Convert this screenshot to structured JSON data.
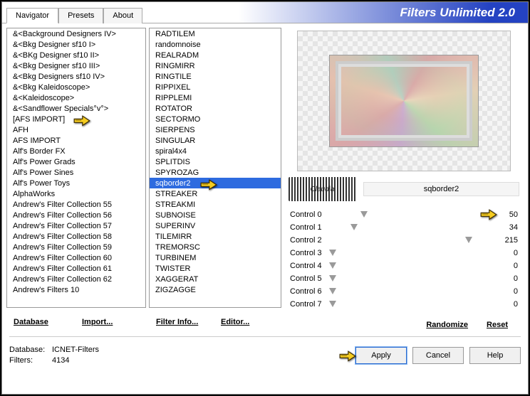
{
  "app_title": "Filters Unlimited 2.0",
  "tabs": [
    "Navigator",
    "Presets",
    "About"
  ],
  "active_tab": 0,
  "left_list": [
    "&<Background Designers IV>",
    "&<Bkg Designer sf10 I>",
    "&<BKg Designer sf10 II>",
    "&<Bkg Designer sf10 III>",
    "&<Bkg Designers sf10 IV>",
    "&<Bkg Kaleidoscope>",
    "&<Kaleidoscope>",
    "&<Sandflower Specials°v°>",
    "[AFS IMPORT]",
    "AFH",
    "AFS IMPORT",
    "Alf's Border FX",
    "Alf's Power Grads",
    "Alf's Power Sines",
    "Alf's Power Toys",
    "AlphaWorks",
    "Andrew's Filter Collection 55",
    "Andrew's Filter Collection 56",
    "Andrew's Filter Collection 57",
    "Andrew's Filter Collection 58",
    "Andrew's Filter Collection 59",
    "Andrew's Filter Collection 60",
    "Andrew's Filter Collection 61",
    "Andrew's Filter Collection 62",
    "Andrew's Filters 10"
  ],
  "left_selected_index": 8,
  "mid_list": [
    "RADTILEM",
    "randomnoise",
    "REALRADM",
    "RINGMIRR",
    "RINGTILE",
    "RIPPIXEL",
    "RIPPLEMI",
    "ROTATOR",
    "SECTORMO",
    "SIERPENS",
    "SINGULAR",
    "spiral4x4",
    "SPLITDIS",
    "SPYROZAG",
    "sqborder2",
    "STREAKER",
    "STREAKMI",
    "SUBNOISE",
    "SUPERINV",
    "TILEMIRR",
    "TREMORSC",
    "TURBINEM",
    "TWISTER",
    "XAGGERAT",
    "ZIGZAGGE"
  ],
  "mid_selected_index": 14,
  "buttons": {
    "database": "Database",
    "import": "Import...",
    "filter_info": "Filter Info...",
    "editor": "Editor...",
    "randomize": "Randomize",
    "reset": "Reset",
    "apply": "Apply",
    "cancel": "Cancel",
    "help": "Help"
  },
  "watermark_text": "Claudia",
  "current_filter_name": "sqborder2",
  "controls": [
    {
      "label": "Control 0",
      "value": 50,
      "max": 255
    },
    {
      "label": "Control 1",
      "value": 34,
      "max": 255
    },
    {
      "label": "Control 2",
      "value": 215,
      "max": 255
    },
    {
      "label": "Control 3",
      "value": 0,
      "max": 255
    },
    {
      "label": "Control 4",
      "value": 0,
      "max": 255
    },
    {
      "label": "Control 5",
      "value": 0,
      "max": 255
    },
    {
      "label": "Control 6",
      "value": 0,
      "max": 255
    },
    {
      "label": "Control 7",
      "value": 0,
      "max": 255
    }
  ],
  "status": {
    "db_label": "Database:",
    "db_value": "ICNET-Filters",
    "filters_label": "Filters:",
    "filters_value": "4134"
  }
}
